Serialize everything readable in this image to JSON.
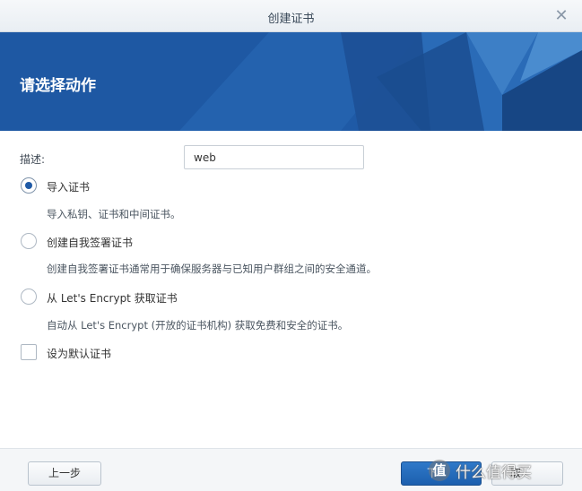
{
  "window": {
    "title": "创建证书",
    "close_icon": "close-icon"
  },
  "banner": {
    "heading": "请选择动作",
    "color": "#1f5aa6"
  },
  "form": {
    "description_label": "描述:",
    "description_value": "web",
    "options": [
      {
        "label": "导入证书",
        "desc": "导入私钥、证书和中间证书。",
        "selected": true
      },
      {
        "label": "创建自我签署证书",
        "desc": "创建自我签署证书通常用于确保服务器与已知用户群组之间的安全通道。",
        "selected": false
      },
      {
        "label": "从 Let's Encrypt 获取证书",
        "desc": "自动从 Let's Encrypt (开放的证书机构) 获取免费和安全的证书。",
        "selected": false
      }
    ],
    "default_checkbox_label": "设为默认证书",
    "default_checked": false
  },
  "footer": {
    "prev_label": "上一步",
    "next_label": "下",
    "cancel_label": "取"
  },
  "watermark": {
    "logo_text": "值",
    "text": "什么值得买"
  }
}
